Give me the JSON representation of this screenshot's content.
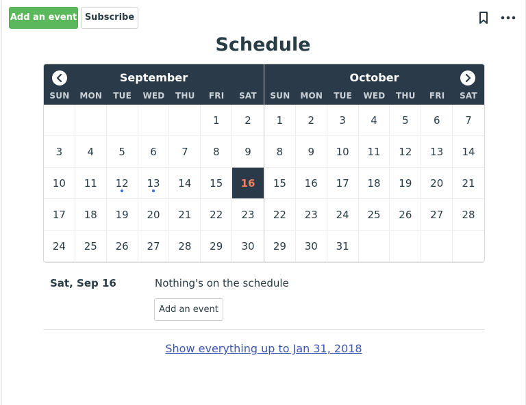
{
  "toolbar": {
    "add_event_label": "Add an event",
    "subscribe_label": "Subscribe",
    "bookmark_icon": "bookmark-icon",
    "more_icon": "more-icon"
  },
  "page": {
    "title": "Schedule"
  },
  "calendar": {
    "weekdays": [
      "SUN",
      "MON",
      "TUE",
      "WED",
      "THU",
      "FRI",
      "SAT"
    ],
    "months": [
      {
        "name": "September",
        "days": [
          "",
          "",
          "",
          "",
          "",
          "1",
          "2",
          "3",
          "4",
          "5",
          "6",
          "7",
          "8",
          "9",
          "10",
          "11",
          "12",
          "13",
          "14",
          "15",
          "16",
          "17",
          "18",
          "19",
          "20",
          "21",
          "22",
          "23",
          "24",
          "25",
          "26",
          "27",
          "28",
          "29",
          "30"
        ],
        "event_days": [
          "12",
          "13"
        ],
        "selected_day": "16"
      },
      {
        "name": "October",
        "days": [
          "1",
          "2",
          "3",
          "4",
          "5",
          "6",
          "7",
          "8",
          "9",
          "10",
          "11",
          "12",
          "13",
          "14",
          "15",
          "16",
          "17",
          "18",
          "19",
          "20",
          "21",
          "22",
          "23",
          "24",
          "25",
          "26",
          "27",
          "28",
          "29",
          "30",
          "31",
          "",
          "",
          "",
          ""
        ],
        "event_days": [],
        "selected_day": ""
      }
    ],
    "prev_icon": "chevron-left-icon",
    "next_icon": "chevron-right-icon"
  },
  "agenda": {
    "selected_date": "Sat, Sep 16",
    "empty_message": "Nothing's on the schedule",
    "add_event_label": "Add an event"
  },
  "footer": {
    "show_all_link": "Show everything up to Jan 31, 2018"
  },
  "colors": {
    "primary_green": "#5cb85c",
    "header_dark": "#2b3a48",
    "today_text": "#f37f63",
    "event_dot": "#3b6bd6",
    "link": "#3c55b4"
  }
}
